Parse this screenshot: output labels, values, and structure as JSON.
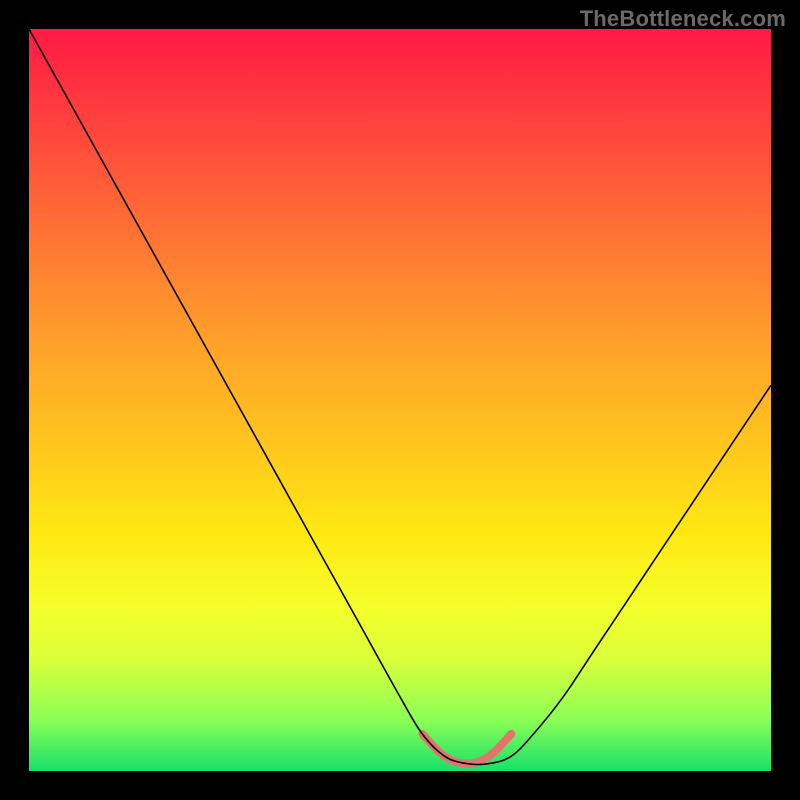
{
  "watermark": "TheBottleneck.com",
  "chart_data": {
    "type": "line",
    "title": "",
    "xlabel": "",
    "ylabel": "",
    "xlim": [
      0,
      100
    ],
    "ylim": [
      0,
      100
    ],
    "grid": false,
    "legend": false,
    "background_gradient": {
      "direction": "vertical",
      "stops": [
        {
          "pct": 0,
          "color": "#ff1a44"
        },
        {
          "pct": 25,
          "color": "#ff6a35"
        },
        {
          "pct": 55,
          "color": "#ffc31f"
        },
        {
          "pct": 78,
          "color": "#f4ff2a"
        },
        {
          "pct": 93,
          "color": "#8cff55"
        },
        {
          "pct": 100,
          "color": "#18e06a"
        }
      ]
    },
    "series": [
      {
        "name": "bottleneck-curve",
        "color": "#000000",
        "width": 1.6,
        "x": [
          0,
          5,
          10,
          15,
          20,
          25,
          30,
          35,
          40,
          45,
          50,
          53,
          56,
          59,
          62,
          65,
          68,
          72,
          76,
          80,
          84,
          88,
          92,
          96,
          100
        ],
        "y": [
          100,
          91,
          82,
          73,
          64,
          55,
          46,
          37,
          28,
          19,
          10,
          5,
          2,
          1,
          1,
          2,
          5,
          10,
          16,
          22,
          28,
          34,
          40,
          46,
          52
        ]
      },
      {
        "name": "optimum-flat-highlight",
        "color": "#e2746c",
        "width": 8,
        "linecap": "round",
        "x": [
          53,
          56,
          59,
          62,
          65
        ],
        "y": [
          5,
          2,
          1,
          2,
          5
        ]
      }
    ]
  }
}
